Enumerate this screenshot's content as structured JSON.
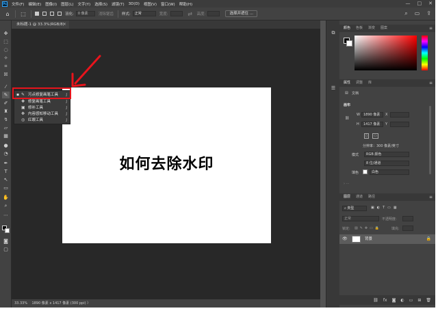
{
  "menubar": {
    "logo": "Ps",
    "items": [
      "文件(F)",
      "编辑(E)",
      "图像(I)",
      "图层(L)",
      "文字(Y)",
      "选择(S)",
      "滤镜(T)",
      "3D(D)",
      "视图(V)",
      "窗口(W)",
      "帮助(H)"
    ],
    "window_controls": [
      "—",
      "□",
      "✕"
    ]
  },
  "options": {
    "feather_label": "羽化:",
    "feather_value": "0 像素",
    "antialias_label": "消除锯齿",
    "style_label": "样式:",
    "style_value": "正常",
    "width_label": "宽度:",
    "height_label": "高度:",
    "select_mask_button": "选择并遮住 ..."
  },
  "document": {
    "tab_title": "未标题-1 @ 33.3%(RGB/8)",
    "canvas_text": "如何去除水印"
  },
  "status": {
    "zoom": "33.33%",
    "info": "1890 像素 x 1417 像素 (300 ppi)"
  },
  "tool_flyout": {
    "items": [
      {
        "label": "污点修复画笔工具",
        "key": "J",
        "icon": "spot-healing-brush-icon",
        "glyph": "✎",
        "active": true
      },
      {
        "label": "修复画笔工具",
        "key": "J",
        "icon": "healing-brush-icon",
        "glyph": "✚",
        "active": false
      },
      {
        "label": "修补工具",
        "key": "J",
        "icon": "patch-icon",
        "glyph": "▣",
        "active": false
      },
      {
        "label": "内容感知移动工具",
        "key": "J",
        "icon": "content-aware-move-icon",
        "glyph": "✥",
        "active": false
      },
      {
        "label": "红眼工具",
        "key": "J",
        "icon": "red-eye-icon",
        "glyph": "◎",
        "active": false
      }
    ]
  },
  "color_panel": {
    "tabs": [
      "颜色",
      "色板",
      "渐变",
      "图案"
    ]
  },
  "properties_panel": {
    "tabs": [
      "属性",
      "调整",
      "库"
    ],
    "doc_label": "文档",
    "section_title": "画布",
    "w_label": "W",
    "w_value": "1890 像素",
    "x_label": "X",
    "h_label": "H",
    "h_value": "1417 像素",
    "y_label": "Y",
    "resolution": "分辨率：300 像素/英寸",
    "mode_label": "模式",
    "mode_value": "RGB 颜色",
    "depth_value": "8 位/通道",
    "fill_label": "填色",
    "fill_value": "白色"
  },
  "layers_panel": {
    "tabs": [
      "图层",
      "通道",
      "路径"
    ],
    "search_placeholder": "类型",
    "blend_mode": "正常",
    "opacity_label": "不透明度:",
    "lock_label": "锁定:",
    "fill_label": "填充:",
    "layer_name": "背景"
  },
  "colors": {
    "highlight": "#e8141c",
    "arrow": "#e8141c",
    "workspace": "#282828",
    "panel": "#424242"
  }
}
